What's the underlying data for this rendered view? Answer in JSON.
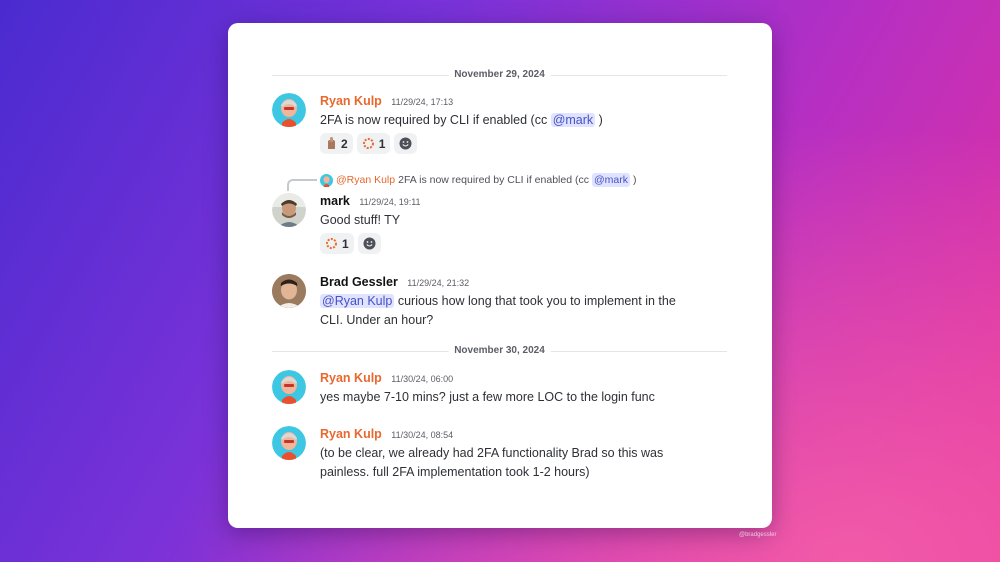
{
  "dividers": [
    "November 29, 2024",
    "November 30, 2024"
  ],
  "messages": [
    {
      "author": "Ryan Kulp",
      "timestamp": "11/29/24, 17:13",
      "text_before": "2FA is now required by CLI if enabled (cc ",
      "mention": "@mark",
      "text_after": " )",
      "reactions": [
        {
          "emoji": "finger-emoji",
          "count": "2"
        },
        {
          "emoji": "sparkle-emoji",
          "count": "1"
        },
        {
          "emoji": "add-reaction-icon",
          "count": ""
        }
      ]
    },
    {
      "reply_to": {
        "mention": "@Ryan Kulp",
        "text": "2FA is now required by CLI if enabled (cc",
        "mention2": "@mark",
        "text_after": ")"
      },
      "author": "mark",
      "timestamp": "11/29/24, 19:11",
      "text": "Good stuff! TY",
      "reactions": [
        {
          "emoji": "sparkle-emoji",
          "count": "1"
        },
        {
          "emoji": "add-reaction-icon",
          "count": ""
        }
      ]
    },
    {
      "author": "Brad Gessler",
      "timestamp": "11/29/24, 21:32",
      "mention": "@Ryan Kulp",
      "text_after_line1": " curious how long that took you to implement in the",
      "text_line2": "CLI. Under an hour?"
    },
    {
      "author": "Ryan Kulp",
      "timestamp": "11/30/24, 06:00",
      "text": "yes maybe 7-10 mins? just a few more LOC to the login func"
    },
    {
      "author": "Ryan Kulp",
      "timestamp": "11/30/24, 08:54",
      "text_line1": "(to be clear, we already had 2FA functionality Brad so this was",
      "text_line2": "painless. full 2FA implementation took 1-2 hours)"
    }
  ],
  "watermark": "@bradgessler",
  "colors": {
    "author_accent": "#e8682e",
    "mention_bg": "#e0e3ff",
    "mention_text": "#4752c4"
  }
}
